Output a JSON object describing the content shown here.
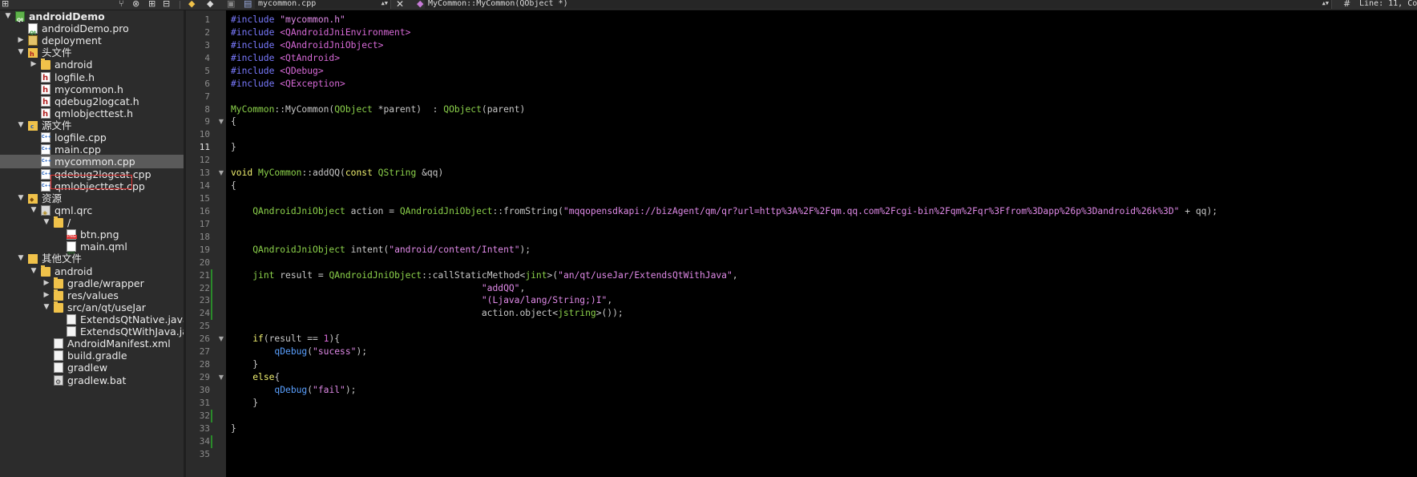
{
  "toolbar": {
    "file_combo": "mycommon.cpp",
    "symbol_combo": "MyCommon::MyCommon(QObject *)",
    "position": "Line: 11, Co"
  },
  "tree": {
    "items": [
      {
        "label": "androidDemo",
        "depth": 0,
        "arrow": "▼",
        "icon": "proj",
        "bold": true
      },
      {
        "label": "androidDemo.pro",
        "depth": 1,
        "arrow": "",
        "icon": "pro"
      },
      {
        "label": "deployment",
        "depth": 1,
        "arrow": "▶",
        "icon": "deploy"
      },
      {
        "label": "头文件",
        "depth": 1,
        "arrow": "▼",
        "icon": "hfolder"
      },
      {
        "label": "android",
        "depth": 2,
        "arrow": "▶",
        "icon": "folder"
      },
      {
        "label": "logfile.h",
        "depth": 2,
        "arrow": "",
        "icon": "h"
      },
      {
        "label": "mycommon.h",
        "depth": 2,
        "arrow": "",
        "icon": "h"
      },
      {
        "label": "qdebug2logcat.h",
        "depth": 2,
        "arrow": "",
        "icon": "h"
      },
      {
        "label": "qmlobjecttest.h",
        "depth": 2,
        "arrow": "",
        "icon": "h"
      },
      {
        "label": "源文件",
        "depth": 1,
        "arrow": "▼",
        "icon": "cfolder"
      },
      {
        "label": "logfile.cpp",
        "depth": 2,
        "arrow": "",
        "icon": "cpp"
      },
      {
        "label": "main.cpp",
        "depth": 2,
        "arrow": "",
        "icon": "cpp"
      },
      {
        "label": "mycommon.cpp",
        "depth": 2,
        "arrow": "",
        "icon": "cpp",
        "selected": true
      },
      {
        "label": "qdebug2logcat.cpp",
        "depth": 2,
        "arrow": "",
        "icon": "cpp"
      },
      {
        "label": "qmlobjecttest.cpp",
        "depth": 2,
        "arrow": "",
        "icon": "cpp"
      },
      {
        "label": "资源",
        "depth": 1,
        "arrow": "▼",
        "icon": "res"
      },
      {
        "label": "qml.qrc",
        "depth": 2,
        "arrow": "▼",
        "icon": "qrc"
      },
      {
        "label": "/",
        "depth": 3,
        "arrow": "▼",
        "icon": "folder"
      },
      {
        "label": "btn.png",
        "depth": 4,
        "arrow": "",
        "icon": "png"
      },
      {
        "label": "main.qml",
        "depth": 4,
        "arrow": "",
        "icon": "qml"
      },
      {
        "label": "其他文件",
        "depth": 1,
        "arrow": "▼",
        "icon": "other"
      },
      {
        "label": "android",
        "depth": 2,
        "arrow": "▼",
        "icon": "folder"
      },
      {
        "label": "gradle/wrapper",
        "depth": 3,
        "arrow": "▶",
        "icon": "folder"
      },
      {
        "label": "res/values",
        "depth": 3,
        "arrow": "▶",
        "icon": "folder"
      },
      {
        "label": "src/an/qt/useJar",
        "depth": 3,
        "arrow": "▼",
        "icon": "folder"
      },
      {
        "label": "ExtendsQtNative.java",
        "depth": 4,
        "arrow": "",
        "icon": "file"
      },
      {
        "label": "ExtendsQtWithJava.java",
        "depth": 4,
        "arrow": "",
        "icon": "file"
      },
      {
        "label": "AndroidManifest.xml",
        "depth": 3,
        "arrow": "",
        "icon": "file"
      },
      {
        "label": "build.gradle",
        "depth": 3,
        "arrow": "",
        "icon": "file"
      },
      {
        "label": "gradlew",
        "depth": 3,
        "arrow": "",
        "icon": "file"
      },
      {
        "label": "gradlew.bat",
        "depth": 3,
        "arrow": "",
        "icon": "bat"
      }
    ]
  },
  "editor": {
    "current_line": 11,
    "fold_lines": [
      9,
      13,
      26,
      29
    ],
    "changed_lines": [
      21,
      22,
      23,
      24,
      32,
      34
    ],
    "lines": [
      [
        [
          "pp",
          "#include "
        ],
        [
          "str",
          "\"mycommon.h\""
        ]
      ],
      [
        [
          "pp",
          "#include "
        ],
        [
          "inc",
          "<QAndroidJniEnvironment>"
        ]
      ],
      [
        [
          "pp",
          "#include "
        ],
        [
          "inc",
          "<QAndroidJniObject>"
        ]
      ],
      [
        [
          "pp",
          "#include "
        ],
        [
          "inc",
          "<QtAndroid>"
        ]
      ],
      [
        [
          "pp",
          "#include "
        ],
        [
          "inc",
          "<QDebug>"
        ]
      ],
      [
        [
          "pp",
          "#include "
        ],
        [
          "inc",
          "<QException>"
        ]
      ],
      [],
      [
        [
          "type",
          "MyCommon"
        ],
        [
          "def",
          "::MyCommon("
        ],
        [
          "type",
          "QObject"
        ],
        [
          "def",
          " *parent)  : "
        ],
        [
          "type",
          "QObject"
        ],
        [
          "def",
          "(parent)"
        ]
      ],
      [
        [
          "def",
          "{"
        ]
      ],
      [],
      [
        [
          "def",
          "}"
        ]
      ],
      [],
      [
        [
          "kw",
          "void "
        ],
        [
          "type",
          "MyCommon"
        ],
        [
          "def",
          "::addQQ("
        ],
        [
          "kw",
          "const "
        ],
        [
          "type",
          "QString"
        ],
        [
          "def",
          " &qq)"
        ]
      ],
      [
        [
          "def",
          "{"
        ]
      ],
      [],
      [
        [
          "def",
          "    "
        ],
        [
          "type",
          "QAndroidJniObject"
        ],
        [
          "def",
          " action = "
        ],
        [
          "type",
          "QAndroidJniObject"
        ],
        [
          "def",
          "::fromString("
        ],
        [
          "str",
          "\"mqqopensdkapi://bizAgent/qm/qr?url=http%3A%2F%2Fqm.qq.com%2Fcgi-bin%2Fqm%2Fqr%3Ffrom%3Dapp%26p%3Dandroid%26k%3D\""
        ],
        [
          "def",
          " + qq);"
        ]
      ],
      [],
      [],
      [
        [
          "def",
          "    "
        ],
        [
          "type",
          "QAndroidJniObject"
        ],
        [
          "def",
          " intent("
        ],
        [
          "str",
          "\"android/content/Intent\""
        ],
        [
          "def",
          ");"
        ]
      ],
      [],
      [
        [
          "def",
          "    "
        ],
        [
          "type",
          "jint"
        ],
        [
          "def",
          " result = "
        ],
        [
          "type",
          "QAndroidJniObject"
        ],
        [
          "def",
          "::callStaticMethod<"
        ],
        [
          "type",
          "jint"
        ],
        [
          "def",
          ">("
        ],
        [
          "str",
          "\"an/qt/useJar/ExtendsQtWithJava\""
        ],
        [
          "def",
          ","
        ]
      ],
      [
        [
          "def",
          "                                              "
        ],
        [
          "str",
          "\"addQQ\""
        ],
        [
          "def",
          ","
        ]
      ],
      [
        [
          "def",
          "                                              "
        ],
        [
          "str",
          "\"(Ljava/lang/String;)I\""
        ],
        [
          "def",
          ","
        ]
      ],
      [
        [
          "def",
          "                                              action.object<"
        ],
        [
          "type",
          "jstring"
        ],
        [
          "def",
          ">());"
        ]
      ],
      [],
      [
        [
          "def",
          "    "
        ],
        [
          "kw",
          "if"
        ],
        [
          "def",
          "(result == "
        ],
        [
          "num",
          "1"
        ],
        [
          "def",
          "){"
        ]
      ],
      [
        [
          "def",
          "        "
        ],
        [
          "fn",
          "qDebug"
        ],
        [
          "def",
          "("
        ],
        [
          "str",
          "\"sucess\""
        ],
        [
          "def",
          ");"
        ]
      ],
      [
        [
          "def",
          "    }"
        ]
      ],
      [
        [
          "def",
          "    "
        ],
        [
          "kw",
          "else"
        ],
        [
          "def",
          "{"
        ]
      ],
      [
        [
          "def",
          "        "
        ],
        [
          "fn",
          "qDebug"
        ],
        [
          "def",
          "("
        ],
        [
          "str",
          "\"fail\""
        ],
        [
          "def",
          ");"
        ]
      ],
      [
        [
          "def",
          "    }"
        ]
      ],
      [],
      [
        [
          "def",
          "}"
        ]
      ],
      [],
      []
    ]
  }
}
